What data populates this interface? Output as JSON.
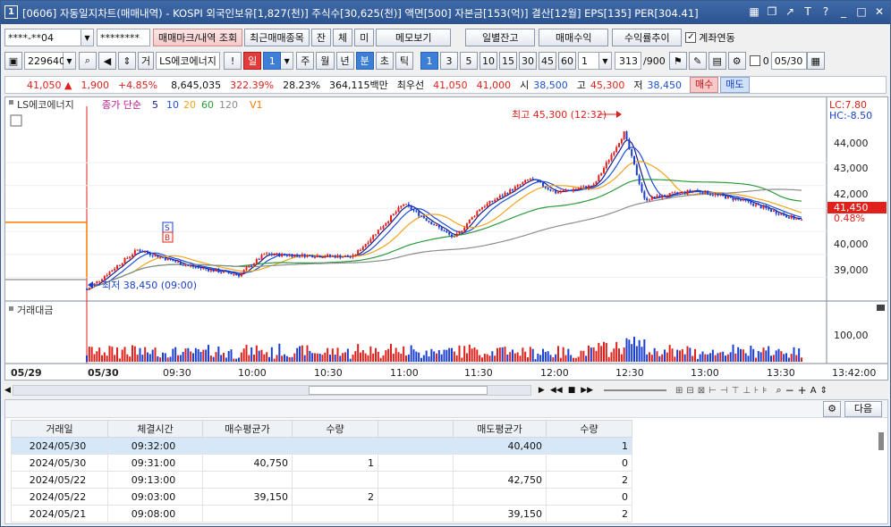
{
  "window": {
    "number": "1",
    "title": "[0606] 자동일지차트(매매내역) - KOSPI 외국인보유[1,827(천)] 주식수[30,625(천)] 액면[500] 자본금[153(억)] 결산[12월] EPS[135] PER[304.41]",
    "icons": [
      "grid-icon",
      "copy-icon",
      "pin-icon",
      "font-icon",
      "help-icon",
      "minimize-icon",
      "maximize-icon",
      "close-icon"
    ]
  },
  "toolbar1": {
    "account": "****-**04",
    "password": "********",
    "btn_trade_mark": "매매마크/내역 조회",
    "btn_recent": "최근매매종목",
    "btn_jan": "잔",
    "btn_che": "체",
    "btn_mi": "미",
    "btn_memo": "메모보기",
    "btn_daily_balance": "일별잔고",
    "btn_trade_profit": "매매수익",
    "btn_return_trend": "수익률추이",
    "chk_account_link": "계좌연동"
  },
  "toolbar2": {
    "code": "229640",
    "geo": "거",
    "name": "LS에코에너지",
    "excl": "!",
    "period_il": "일",
    "period_il_num": "1",
    "periods": [
      "주",
      "월",
      "년"
    ],
    "period_min": "분",
    "periods2": [
      "초",
      "틱"
    ],
    "minutes": [
      "1",
      "3",
      "5",
      "10",
      "15",
      "30",
      "45",
      "60"
    ],
    "multiplier": "1",
    "count": "313",
    "count_max": "/900",
    "date_zero": "0",
    "date": "05/30"
  },
  "quote": {
    "price": "41,050",
    "arrow": "▲",
    "change": "1,900",
    "pct": "+4.85%",
    "volume": "8,645,035",
    "vol_ratio": "322.39%",
    "turnover": "28.23%",
    "amount": "364,115백만",
    "best_label": "최우선",
    "ask": "41,050",
    "bid": "41,000",
    "open_label": "시",
    "open": "38,500",
    "high_label": "고",
    "high": "45,300",
    "low_label": "저",
    "low": "38,450",
    "buy": "매수",
    "sell": "매도"
  },
  "chart": {
    "legend_name": "LS에코에너지",
    "legend_series": "종가 단순",
    "ma": [
      "5",
      "10",
      "20",
      "60",
      "120"
    ],
    "v1": "V1",
    "lc": "LC:7.80",
    "hc": "HC:-8.50",
    "high_note": "최고 45,300 (12:32)",
    "low_note": "최저 38,450 (09:00)",
    "price_tag": "41,450",
    "pct_tag": "0.48%",
    "marker_s": "S",
    "marker_b": "B",
    "volume_title": "거래대금",
    "y_ticks": [
      "44,000",
      "43,000",
      "42,000",
      "41,000",
      "40,000",
      "39,000"
    ],
    "vol_tick": "100,00",
    "x_labels": [
      "05/29",
      "05/30",
      "09:30",
      "10:00",
      "10:30",
      "11:00",
      "11:30",
      "12:00",
      "12:30",
      "13:00",
      "13:30",
      "13:42:00"
    ],
    "colors": {
      "up": "#e0201b",
      "down": "#1a3fd1",
      "ma5": "#1a1a8c",
      "ma10": "#1e4fd6",
      "ma20": "#f0a51e",
      "ma60": "#2a9a3a",
      "ma120": "#8c8c8c",
      "v1": "#ff7a00"
    }
  },
  "chart_data": {
    "type": "candlestick",
    "x_range": [
      "09:00",
      "13:42"
    ],
    "ylim": [
      38200,
      45600
    ],
    "day_open": 38500,
    "day_high": 45300,
    "day_low": 38450,
    "last": 41450,
    "key_points": [
      {
        "t": "09:00",
        "price": 38450
      },
      {
        "t": "09:20",
        "price": 40200
      },
      {
        "t": "09:40",
        "price": 39500
      },
      {
        "t": "10:00",
        "price": 39100
      },
      {
        "t": "10:10",
        "price": 40000
      },
      {
        "t": "10:45",
        "price": 39900
      },
      {
        "t": "11:05",
        "price": 42200
      },
      {
        "t": "11:25",
        "price": 40700
      },
      {
        "t": "11:35",
        "price": 42000
      },
      {
        "t": "11:55",
        "price": 43300
      },
      {
        "t": "12:05",
        "price": 42700
      },
      {
        "t": "12:20",
        "price": 43000
      },
      {
        "t": "12:32",
        "price": 45300
      },
      {
        "t": "12:40",
        "price": 42400
      },
      {
        "t": "13:00",
        "price": 42800
      },
      {
        "t": "13:20",
        "price": 42300
      },
      {
        "t": "13:42",
        "price": 41450
      }
    ]
  },
  "bottom": {
    "next_btn": "다음",
    "headers": [
      "거래일",
      "체결시간",
      "매수평균가",
      "수량",
      "",
      "매도평균가",
      "수량"
    ],
    "rows": [
      [
        "2024/05/30",
        "09:32:00",
        "",
        "",
        "",
        "40,400",
        "1"
      ],
      [
        "2024/05/30",
        "09:31:00",
        "40,750",
        "1",
        "",
        "",
        "0"
      ],
      [
        "2024/05/22",
        "09:13:00",
        "",
        "",
        "",
        "42,750",
        "2"
      ],
      [
        "2024/05/22",
        "09:03:00",
        "39,150",
        "2",
        "",
        "",
        "0"
      ],
      [
        "2024/05/21",
        "09:08:00",
        "",
        "",
        "",
        "39,150",
        "2"
      ]
    ]
  }
}
